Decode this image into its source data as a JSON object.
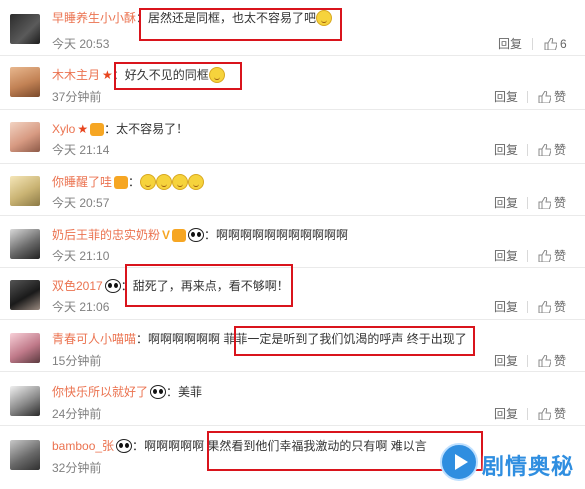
{
  "colors": {
    "username": "#eb7350",
    "highlight": "#d9141c",
    "watermark": "#2f8ee0"
  },
  "actions": {
    "reply_label": "回复",
    "like_label": "赞"
  },
  "comments": [
    {
      "user": "早睡养生小小酥",
      "text": "居然还是同框，也太不容易了吧",
      "time": "今天 20:53",
      "likes": "6",
      "emoji": "surprised-emoji",
      "badges": []
    },
    {
      "user": "木木主月",
      "text": "好久不见的同框",
      "time": "37分钟前",
      "likes": "赞",
      "emoji": "smile-emoji",
      "badges": [
        "star-badge"
      ]
    },
    {
      "user": "Xylo",
      "text": "太不容易了！",
      "time": "今天 21:14",
      "likes": "赞",
      "emoji": "",
      "badges": [
        "star-badge",
        "fan-badge"
      ]
    },
    {
      "user": "你睡醒了哇",
      "text": "",
      "time": "今天 20:57",
      "likes": "赞",
      "emoji": "four-emojis",
      "badges": [
        "fan-badge"
      ]
    },
    {
      "user": "奶后王菲的忠实奶粉",
      "text": "啊啊啊啊啊啊啊啊啊啊啊",
      "time": "今天 21:10",
      "likes": "赞",
      "emoji": "",
      "badges": [
        "verified-badge",
        "fan-badge",
        "panda-badge"
      ]
    },
    {
      "user": "双色2017",
      "text": "甜死了，再来点，看不够啊！",
      "time": "今天 21:06",
      "likes": "赞",
      "emoji": "",
      "badges": [
        "panda-badge"
      ]
    },
    {
      "user": "青春可人小喵喵",
      "text": "啊啊啊啊啊啊 菲菲一定是听到了我们饥渴的呼声 终于出现了",
      "time": "15分钟前",
      "likes": "赞",
      "emoji": "",
      "badges": []
    },
    {
      "user": "你快乐所以就好了",
      "text": "美菲",
      "time": "24分钟前",
      "likes": "赞",
      "emoji": "",
      "badges": [
        "panda-badge"
      ]
    },
    {
      "user": "bamboo_张",
      "text": "啊啊啊啊啊 果然看到他们幸福我激动的只有啊 难以言",
      "time": "32分钟前",
      "likes": "赞",
      "emoji": "",
      "badges": [
        "panda-badge"
      ]
    }
  ],
  "watermark": {
    "text": "剧情奥秘"
  }
}
